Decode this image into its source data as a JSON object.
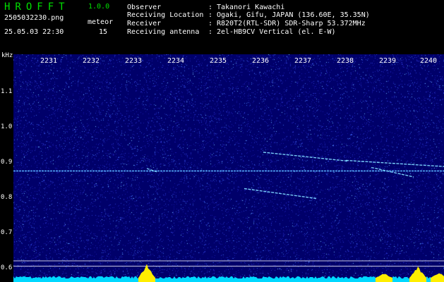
{
  "header": {
    "app_title": "HROFFT",
    "app_version": "1.0.0",
    "filename": "2505032230.png",
    "datetime": "25.05.03 22:30",
    "meteor_label": "meteor",
    "meteor_count": "15",
    "info_rows": [
      {
        "key": "Observer",
        "value": "Takanori Kawachi"
      },
      {
        "key": "Receiving Location",
        "value": "Ogaki, Gifu, JAPAN (136.60E, 35.35N)"
      },
      {
        "key": "Receiver",
        "value": "R820T2(RTL-SDR) SDR-Sharp 53.372MHz"
      },
      {
        "key": "Receiving antenna",
        "value": "2el-HB9CV Vertical (el. E-W)"
      }
    ]
  },
  "y_axis": {
    "unit": "kHz",
    "ticks": [
      "1.1",
      "1.0",
      "0.9",
      "0.8",
      "0.7",
      "0.6"
    ],
    "tick_values": [
      1.1,
      1.0,
      0.9,
      0.8,
      0.7,
      0.6
    ]
  },
  "x_axis": {
    "ticks": [
      "2231",
      "2232",
      "2233",
      "2234",
      "2235",
      "2236",
      "2237",
      "2238",
      "2239",
      "2240"
    ],
    "tick_values": [
      2231,
      2232,
      2233,
      2234,
      2235,
      2236,
      2237,
      2238,
      2239,
      2240
    ],
    "range": [
      2230.4,
      2240.4
    ]
  },
  "spectrogram": {
    "carrier_khz": 0.875,
    "echoes": [
      {
        "t0": 2233.3,
        "f0": 0.882,
        "t1": 2233.55,
        "f1": 0.872
      },
      {
        "t0": 2235.6,
        "f0": 0.825,
        "t1": 2237.3,
        "f1": 0.797
      },
      {
        "t0": 2236.05,
        "f0": 0.928,
        "t1": 2238.05,
        "f1": 0.903
      },
      {
        "t0": 2238.0,
        "f0": 0.905,
        "t1": 2240.4,
        "f1": 0.887
      },
      {
        "t0": 2238.6,
        "f0": 0.885,
        "t1": 2239.6,
        "f1": 0.858
      }
    ],
    "colors": {
      "noise": "#00006a",
      "echo": "#7fd8ff",
      "carrier": "#5ab4ff"
    }
  },
  "bottom_band_lines_khz": [
    0.62,
    0.605
  ],
  "activity_bursts": [
    {
      "t": 2233.3,
      "level": 0.9
    },
    {
      "t": 2239.7,
      "level": 0.75
    },
    {
      "t": 2238.9,
      "level": 0.3
    },
    {
      "t": 2240.2,
      "level": 0.35
    }
  ]
}
